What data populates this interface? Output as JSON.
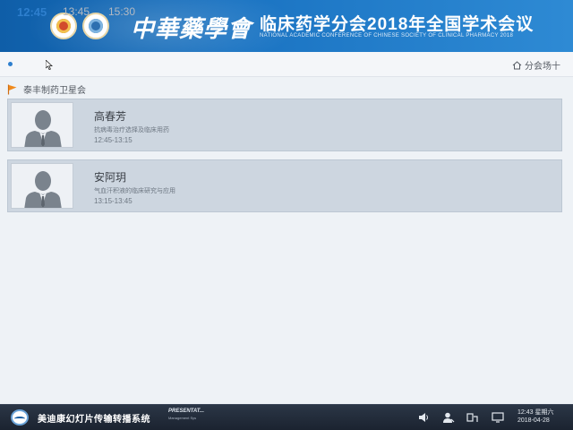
{
  "banner": {
    "brand_script": "中華藥學會",
    "title": "临床药学分会2018年全国学术会议",
    "subtitle": "NATIONAL ACADEMIC CONFERENCE OF CHINESE SOCIETY OF CLINICAL PHARMACY 2018"
  },
  "time_tabs": [
    {
      "label": "12:45",
      "active": true
    },
    {
      "label": "13:45",
      "active": false
    },
    {
      "label": "15:30",
      "active": false
    }
  ],
  "venue": {
    "label": "分会场十",
    "icon": "home-icon"
  },
  "session": {
    "title": "泰丰制药卫星会",
    "icon": "flag-icon",
    "color": "#f08a1c"
  },
  "talks": [
    {
      "speaker": "高春芳",
      "topic": "抗病毒治疗选择及临床用药",
      "time": "12:45-13:15"
    },
    {
      "speaker": "安阿玥",
      "topic": "气血汗积液的临床研究与应用",
      "time": "13:15-13:45"
    }
  ],
  "taskbar": {
    "system_name": "美迪康幻灯片传输转播系统",
    "brand": "PRESENTAT...",
    "brand_sub": "Management Sys",
    "clock_time": "12:43 星期六",
    "clock_date": "2018-04-28"
  },
  "colors": {
    "accent": "#2e7fce",
    "banner": "#1a73c2",
    "card": "#cdd6e0"
  }
}
